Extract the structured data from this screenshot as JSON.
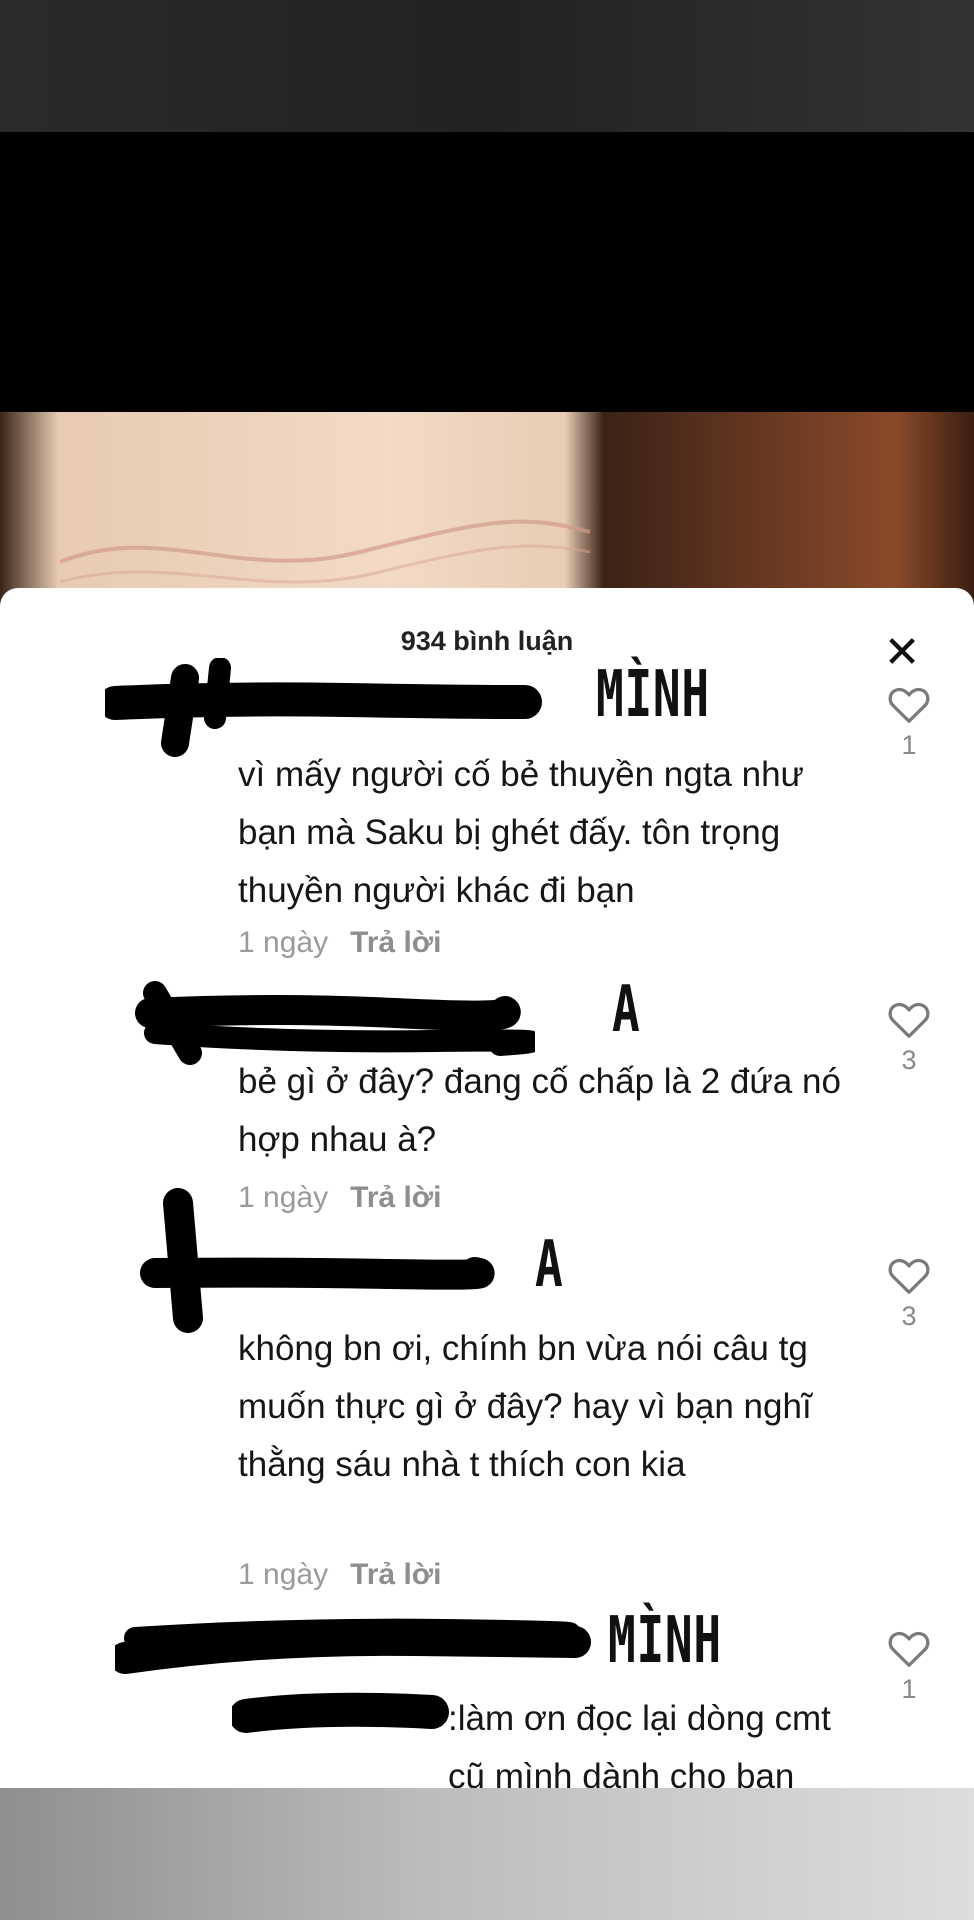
{
  "header": {
    "comment_count": "934 bình luận"
  },
  "comments": [
    {
      "annotation": "MÌNH",
      "text": "vì mấy người cố bẻ thuyền ngta như bạn mà Saku bị ghét đấy. tôn trọng thuyền người khác đi bạn",
      "time": "1 ngày",
      "reply_label": "Trả lời",
      "likes": "1"
    },
    {
      "annotation": "A",
      "text": "bẻ gì ở đây? đang cố chấp là 2 đứa nó hợp nhau à?",
      "time": "1 ngày",
      "reply_label": "Trả lời",
      "likes": "3"
    },
    {
      "annotation": "A",
      "text": "không bn ơi, chính bn vừa nói câu tg muốn thực gì ở đây? hay vì bạn nghĩ thằng sáu nhà t thích con kia",
      "time": "1 ngày",
      "reply_label": "Trả lời",
      "likes": "3"
    },
    {
      "annotation": "MÌNH",
      "text": ":làm ơn đọc lại dòng cmt cũ mình dành cho bạn",
      "likes": "1"
    }
  ],
  "colors": {
    "sheet_bg": "#ffffff",
    "text": "#161616",
    "meta": "#9a9a9a",
    "redaction": "#000000"
  },
  "icons": {
    "close": "close-icon",
    "like": "heart-outline-icon"
  }
}
